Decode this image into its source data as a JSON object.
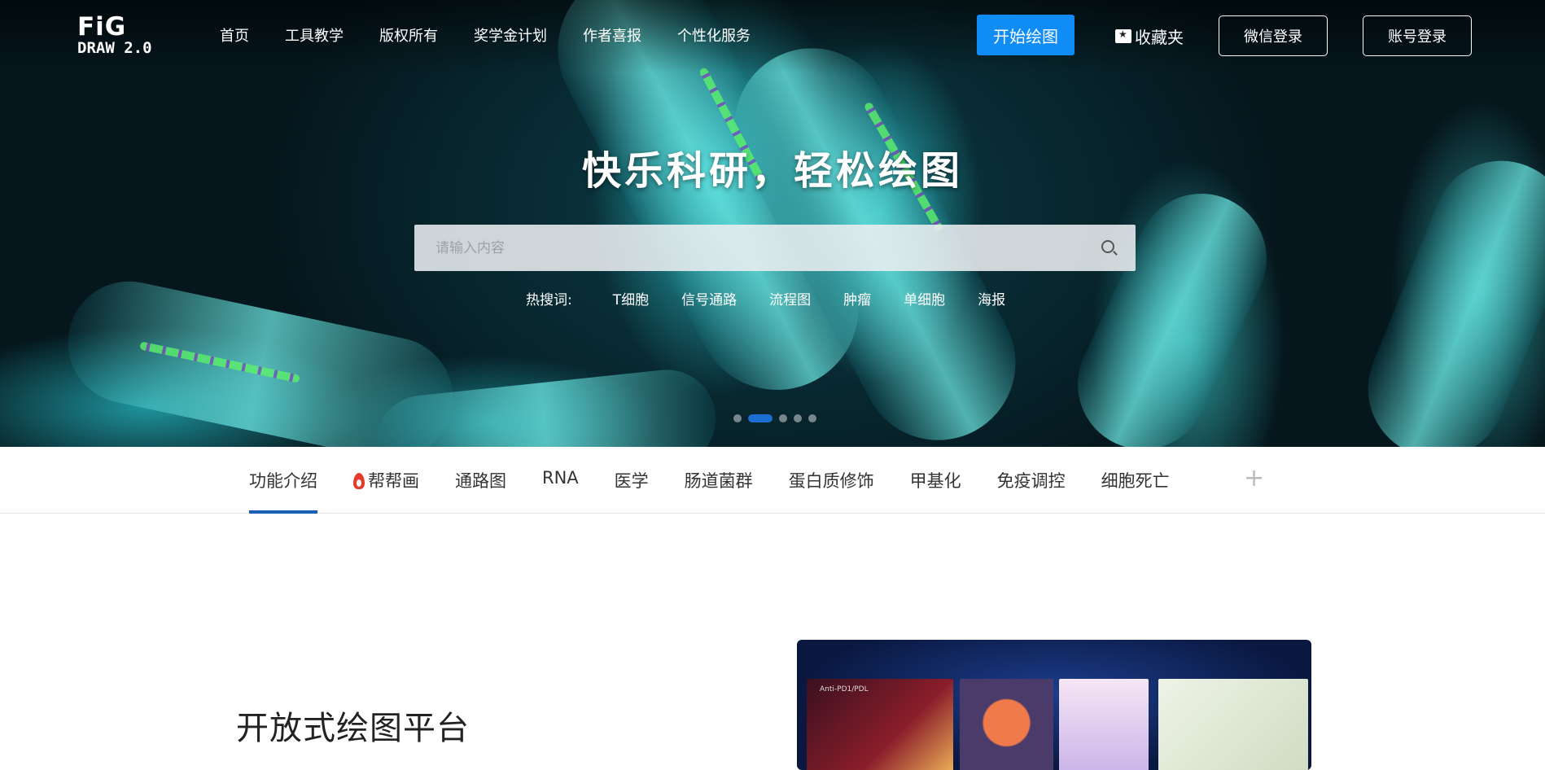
{
  "logo": {
    "line1": "FiG",
    "line2": "DRAW 2.0"
  },
  "nav": {
    "links": [
      "首页",
      "工具教学",
      "版权所有",
      "奖学金计划",
      "作者喜报",
      "个性化服务"
    ],
    "start_button": "开始绘图",
    "favorites": "收藏夹",
    "wechat_login": "微信登录",
    "account_login": "账号登录"
  },
  "hero": {
    "headline": "快乐科研，轻松绘图",
    "search_placeholder": "请输入内容",
    "hot_label": "热搜词:",
    "hot_tags": [
      "T细胞",
      "信号通路",
      "流程图",
      "肿瘤",
      "单细胞",
      "海报"
    ],
    "carousel": {
      "count": 5,
      "active_index": 1
    }
  },
  "tabs": {
    "items": [
      "功能介绍",
      "帮帮画",
      "通路图",
      "RNA",
      "医学",
      "肠道菌群",
      "蛋白质修饰",
      "甲基化",
      "免疫调控",
      "细胞死亡"
    ],
    "active_index": 0
  },
  "section": {
    "title": "开放式绘图平台",
    "showcase_label": "Anti-PD1/PDL"
  },
  "colors": {
    "accent": "#0f8cf5",
    "tab_underline": "#1a5fb4",
    "flame": "#e53b2c"
  }
}
